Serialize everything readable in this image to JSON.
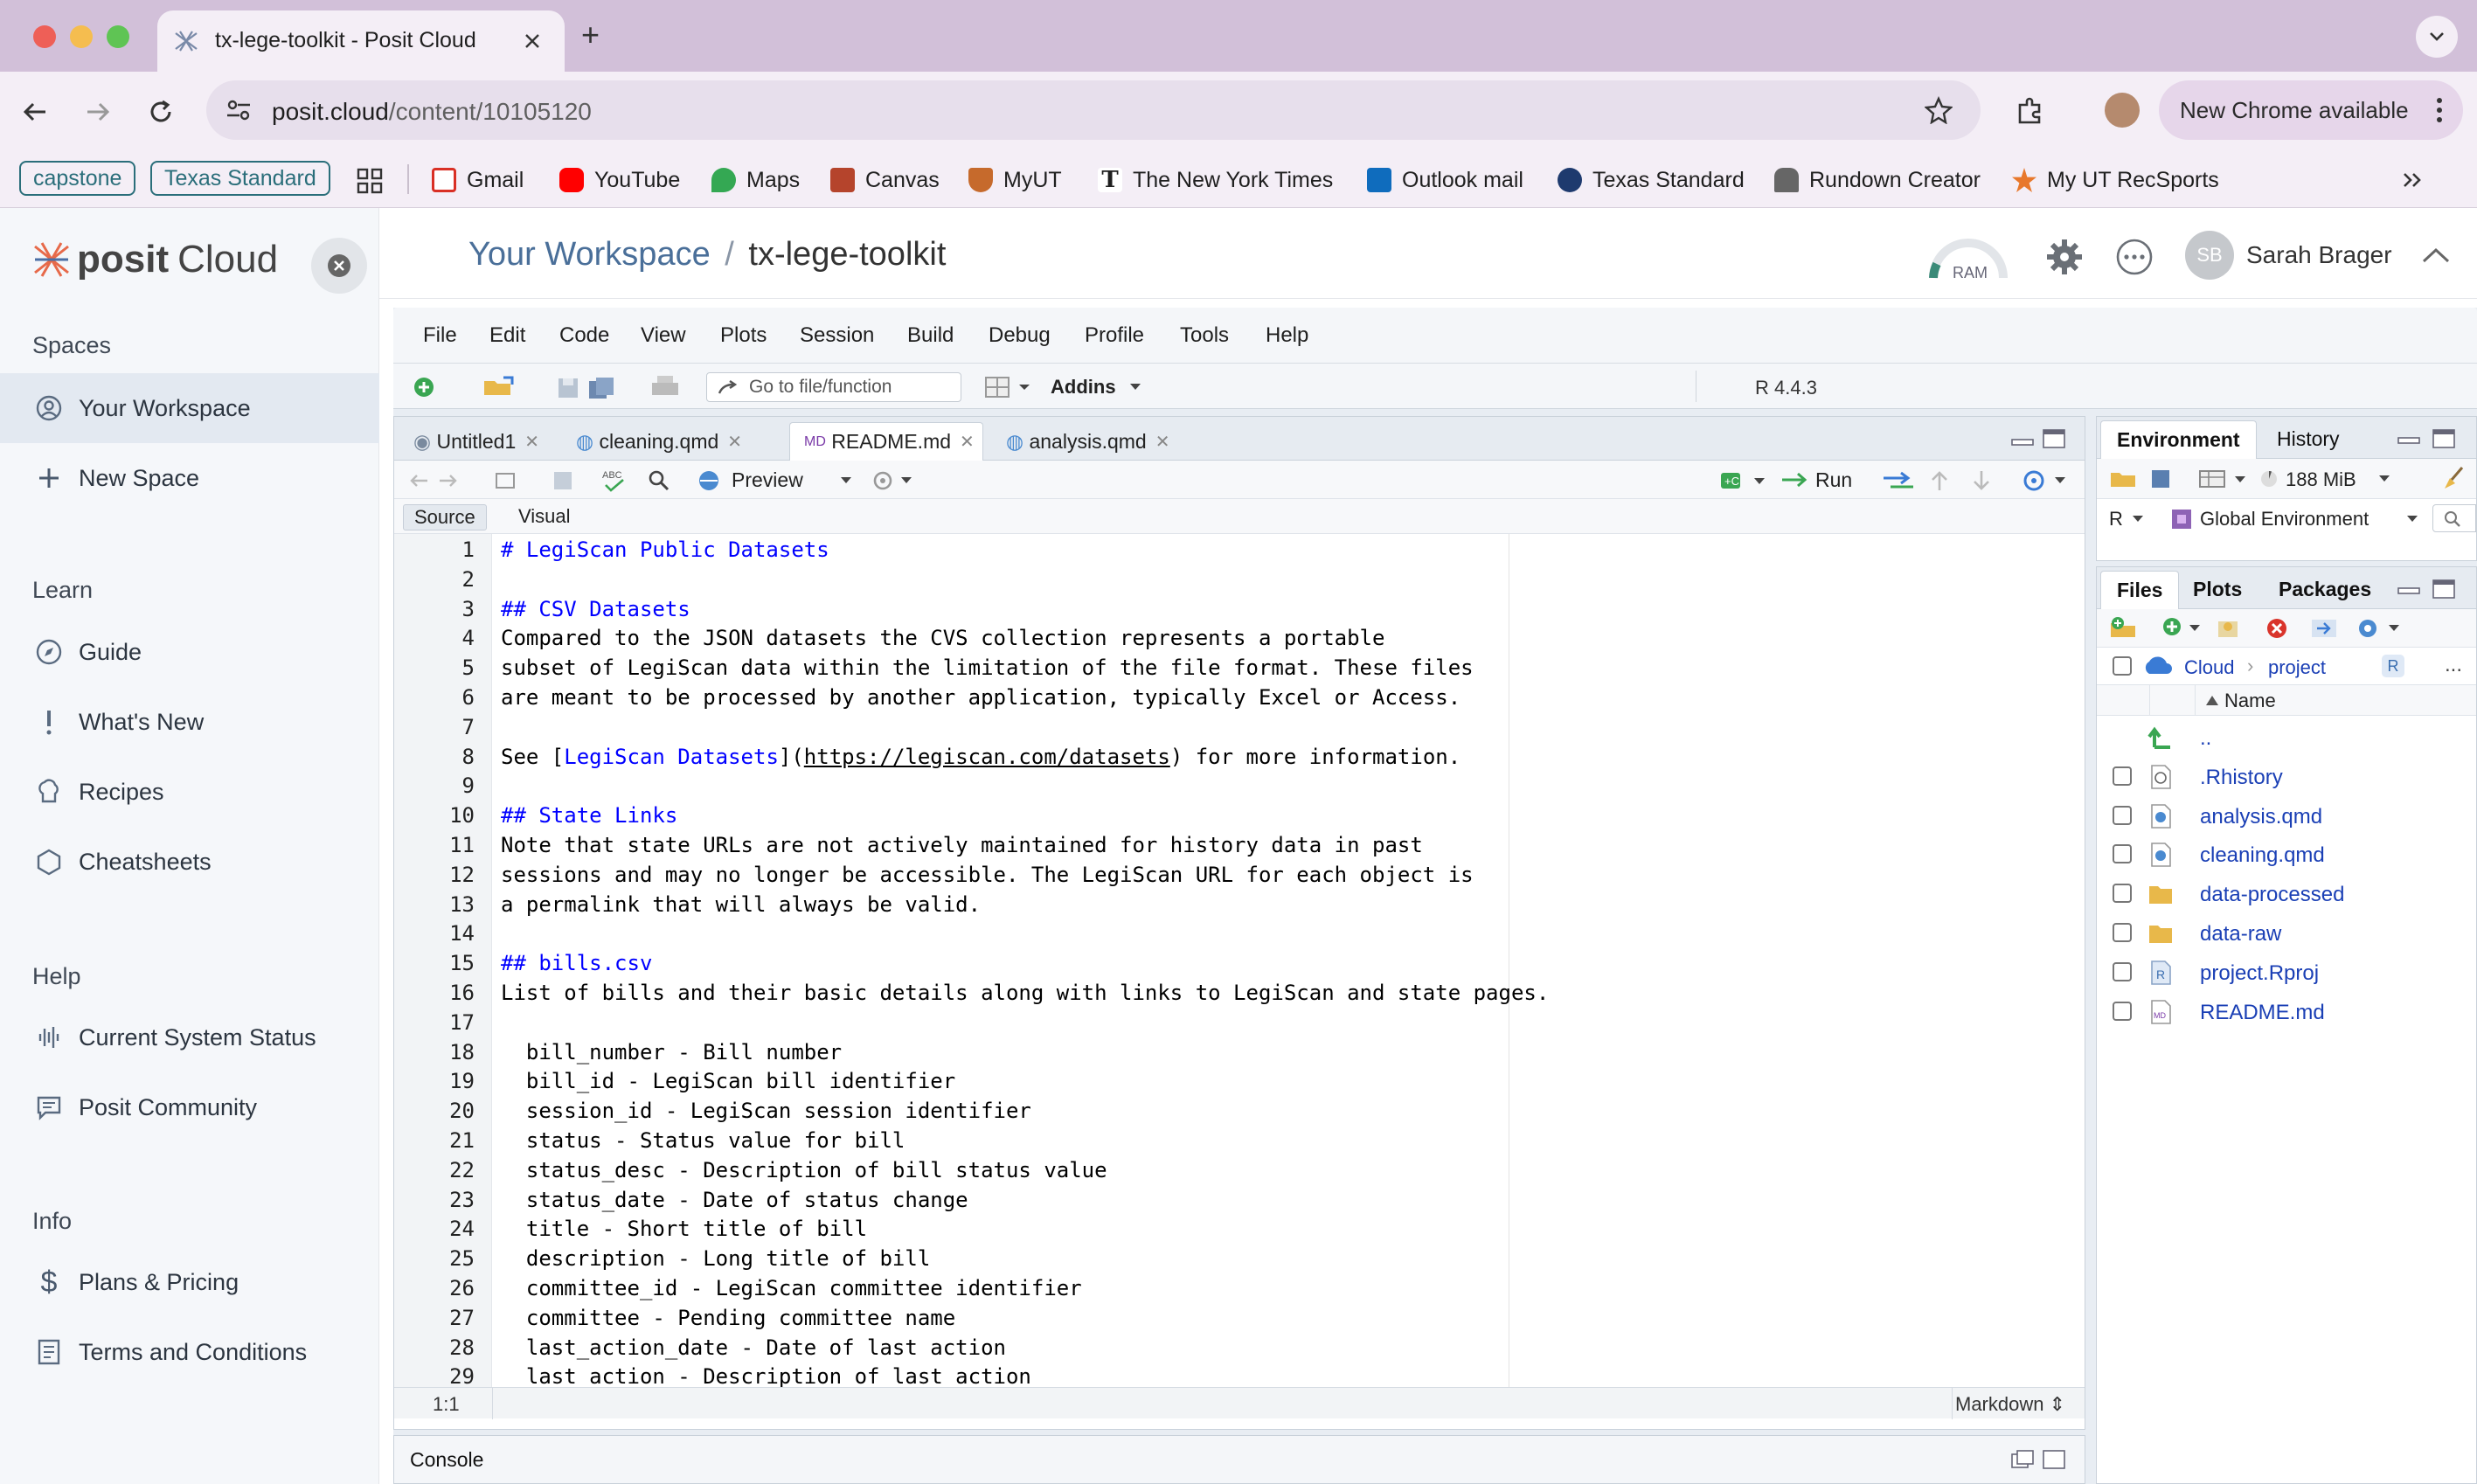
{
  "browser": {
    "tab_title": "tx-lege-toolkit - Posit Cloud",
    "url_domain": "posit.cloud",
    "url_path": "/content/10105120",
    "update_label": "New Chrome available",
    "bookmarks": [
      "capstone",
      "Texas Standard",
      "Gmail",
      "YouTube",
      "Maps",
      "Canvas",
      "MyUT",
      "The New York Times",
      "Outlook mail",
      "Texas Standard",
      "Rundown Creator",
      "My UT RecSports"
    ]
  },
  "sidebar": {
    "logo_bold": "posit",
    "logo_light": "Cloud",
    "spaces_heading": "Spaces",
    "spaces": [
      "Your Workspace",
      "New Space"
    ],
    "learn_heading": "Learn",
    "learn": [
      "Guide",
      "What's New",
      "Recipes",
      "Cheatsheets"
    ],
    "help_heading": "Help",
    "help": [
      "Current System Status",
      "Posit Community"
    ],
    "info_heading": "Info",
    "info": [
      "Plans & Pricing",
      "Terms and Conditions"
    ]
  },
  "header": {
    "workspace": "Your Workspace",
    "separator": "/",
    "project": "tx-lege-toolkit",
    "ram_label": "RAM",
    "user_initials": "SB",
    "user_name": "Sarah Brager"
  },
  "rstudio": {
    "menu": [
      "File",
      "Edit",
      "Code",
      "View",
      "Plots",
      "Session",
      "Build",
      "Debug",
      "Profile",
      "Tools",
      "Help"
    ],
    "goto_placeholder": "Go to file/function",
    "addins": "Addins",
    "r_version": "R 4.4.3",
    "editor_tabs": [
      "Untitled1",
      "cleaning.qmd",
      "README.md",
      "analysis.qmd"
    ],
    "preview": "Preview",
    "run": "Run",
    "source": "Source",
    "visual": "Visual",
    "cursor_pos": "1:1",
    "file_type": "Markdown",
    "console": "Console",
    "env_tabs": [
      "Environment",
      "History"
    ],
    "memory": "188 MiB",
    "lang": "R",
    "global_env": "Global Environment",
    "files_tabs": [
      "Files",
      "Plots",
      "Packages"
    ],
    "path": [
      "Cloud",
      "project"
    ],
    "name_col": "Name",
    "files": [
      "..",
      ".Rhistory",
      "analysis.qmd",
      "cleaning.qmd",
      "data-processed",
      "data-raw",
      "project.Rproj",
      "README.md"
    ],
    "code_lines": [
      "# LegiScan Public Datasets",
      "",
      "## CSV Datasets",
      "Compared to the JSON datasets the CVS collection represents a portable",
      "subset of LegiScan data within the limitation of the file format. These files",
      "are meant to be processed by another application, typically Excel or Access.",
      "",
      "See [LegiScan Datasets](https://legiscan.com/datasets) for more information.",
      "",
      "## State Links",
      "Note that state URLs are not actively maintained for history data in past",
      "sessions and may no longer be accessible. The LegiScan URL for each object is",
      "a permalink that will always be valid.",
      "",
      "## bills.csv",
      "List of bills and their basic details along with links to LegiScan and state pages.",
      "",
      "  bill_number - Bill number",
      "  bill_id - LegiScan bill identifier",
      "  session_id - LegiScan session identifier",
      "  status - Status value for bill",
      "  status_desc - Description of bill status value",
      "  status_date - Date of status change",
      "  title - Short title of bill",
      "  description - Long title of bill",
      "  committee_id - LegiScan committee identifier",
      "  committee - Pending committee name",
      "  last_action_date - Date of last action",
      "  last_action - Description of last action"
    ]
  }
}
